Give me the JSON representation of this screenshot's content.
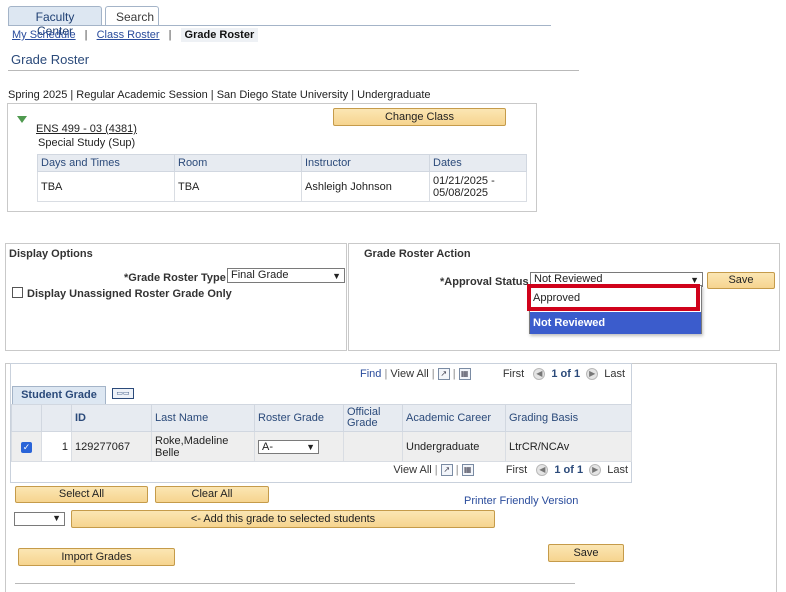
{
  "tabs": [
    {
      "label": "Faculty Center",
      "active": true
    },
    {
      "label": "Search",
      "active": false
    }
  ],
  "breadcrumbs": {
    "items": [
      "My Schedule",
      "Class Roster"
    ],
    "separator": "|",
    "current": "Grade Roster"
  },
  "page_title": "Grade Roster",
  "session_line": "Spring 2025 | Regular Academic Session | San Diego State University | Undergraduate",
  "class_info": {
    "class_link": "ENS 499 - 03 (4381)",
    "class_desc": "Special Study (Sup)",
    "change_class_label": "Change Class",
    "schedule": {
      "headers": [
        "Days and Times",
        "Room",
        "Instructor",
        "Dates"
      ],
      "row": [
        "TBA",
        "TBA",
        "Ashleigh Johnson",
        "01/21/2025 - 05/08/2025"
      ]
    }
  },
  "display_options": {
    "title": "Display Options",
    "roster_type_label": "*Grade Roster Type",
    "roster_type_value": "Final Grade",
    "unassigned_label": "Display Unassigned Roster Grade Only"
  },
  "roster_action": {
    "title": "Grade Roster Action",
    "approval_label": "*Approval Status",
    "approval_value": "Not Reviewed",
    "save_label": "Save",
    "dropdown_options": [
      "Approved",
      "Not Reviewed"
    ],
    "highlight_color": "#d0021b",
    "selected_option_color": "#3b5ccc"
  },
  "grid": {
    "find_label": "Find",
    "view_all_label": "View All",
    "first_label": "First",
    "range_label": "1 of 1",
    "last_label": "Last",
    "tab_label": "Student Grade",
    "headers": [
      "ID",
      "Last Name",
      "Roster Grade",
      "Official Grade",
      "Academic Career",
      "Grading Basis"
    ],
    "rows": [
      {
        "num": "1",
        "id": "129277067",
        "last_name": "Roke,Madeline Belle",
        "roster_grade": "A-",
        "official_grade": "",
        "career": "Undergraduate",
        "basis": "LtrCR/NCAv"
      }
    ]
  },
  "actions": {
    "select_all": "Select All",
    "clear_all": "Clear All",
    "printer_friendly": "Printer Friendly Version",
    "add_grade": "<- Add this grade to selected students",
    "import_grades": "Import Grades",
    "save_label": "Save"
  }
}
